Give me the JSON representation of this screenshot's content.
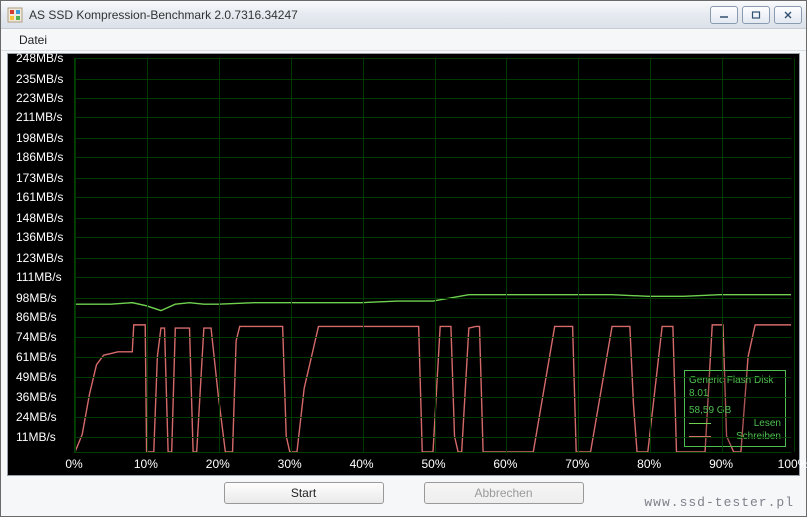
{
  "window": {
    "title": "AS SSD Kompression-Benchmark 2.0.7316.34247"
  },
  "menu": {
    "file": "Datei"
  },
  "buttons": {
    "start": "Start",
    "cancel": "Abbrechen"
  },
  "legend": {
    "device": "Generic Flash Disk",
    "version": "8.01",
    "capacity": "58,59 GB",
    "read": "Lesen",
    "write": "Schreiben",
    "read_color": "#6fd24f",
    "write_color": "#d66a6a"
  },
  "watermark": "www.ssd-tester.pl",
  "chart_data": {
    "type": "line",
    "xlabel": "",
    "ylabel": "",
    "title": "",
    "xlim": [
      0,
      100
    ],
    "ylim": [
      0,
      248
    ],
    "y_ticks": [
      11,
      24,
      36,
      49,
      61,
      74,
      86,
      98,
      111,
      123,
      136,
      148,
      161,
      173,
      186,
      198,
      211,
      223,
      235,
      248
    ],
    "y_tick_labels": [
      "11MB/s",
      "24MB/s",
      "36MB/s",
      "49MB/s",
      "61MB/s",
      "74MB/s",
      "86MB/s",
      "98MB/s",
      "111MB/s",
      "123MB/s",
      "136MB/s",
      "148MB/s",
      "161MB/s",
      "173MB/s",
      "186MB/s",
      "198MB/s",
      "211MB/s",
      "223MB/s",
      "235MB/s",
      "248MB/s"
    ],
    "x_ticks": [
      0,
      10,
      20,
      30,
      40,
      50,
      60,
      70,
      80,
      90,
      100
    ],
    "x_tick_labels": [
      "0%",
      "10%",
      "20%",
      "30%",
      "40%",
      "50%",
      "60%",
      "70%",
      "80%",
      "90%",
      "100%"
    ],
    "series": [
      {
        "name": "Lesen",
        "color": "#6fd24f",
        "x": [
          0,
          2,
          5,
          8,
          10,
          12,
          14,
          16,
          18,
          20,
          25,
          30,
          35,
          40,
          45,
          50,
          55,
          60,
          65,
          70,
          75,
          80,
          85,
          90,
          95,
          100
        ],
        "y": [
          93,
          93,
          93,
          94,
          92,
          89,
          93,
          94,
          93,
          93,
          94,
          94,
          94,
          94,
          95,
          95,
          99,
          99,
          99,
          99,
          99,
          98,
          98,
          99,
          99,
          99
        ]
      },
      {
        "name": "Schreiben",
        "color": "#d66a6a",
        "x": [
          0,
          1,
          2,
          3,
          4,
          5,
          6,
          7,
          8,
          8.2,
          9,
          9.8,
          10,
          11,
          11.5,
          12,
          12.5,
          13,
          13.5,
          14,
          15,
          16,
          16.5,
          17,
          18,
          19,
          20,
          21,
          22,
          22.5,
          23,
          24,
          25,
          28,
          29,
          29.5,
          30,
          31,
          32,
          34,
          46,
          47,
          48,
          48.5,
          49,
          50,
          51,
          52,
          52.5,
          53,
          53.5,
          54,
          55,
          56,
          56.5,
          57,
          58,
          64,
          67,
          68,
          69,
          69.5,
          70,
          71,
          72,
          75,
          76,
          77,
          77.5,
          78,
          78.5,
          79,
          80,
          82,
          83,
          83.5,
          84,
          85,
          88,
          89,
          90,
          90.5,
          91,
          92,
          93,
          94,
          95,
          100
        ],
        "y": [
          0,
          11,
          36,
          55,
          61,
          62,
          63,
          63,
          63,
          80,
          80,
          80,
          0,
          0,
          60,
          78,
          78,
          0,
          0,
          78,
          78,
          78,
          0,
          0,
          78,
          78,
          36,
          0,
          0,
          70,
          79,
          79,
          79,
          79,
          79,
          10,
          0,
          0,
          40,
          79,
          79,
          79,
          79,
          0,
          0,
          0,
          79,
          79,
          79,
          10,
          0,
          0,
          78,
          79,
          79,
          0,
          0,
          0,
          79,
          79,
          79,
          79,
          0,
          0,
          0,
          79,
          79,
          79,
          79,
          30,
          0,
          0,
          0,
          79,
          79,
          79,
          0,
          0,
          0,
          80,
          80,
          80,
          10,
          0,
          0,
          60,
          80,
          80,
          80
        ]
      }
    ]
  }
}
